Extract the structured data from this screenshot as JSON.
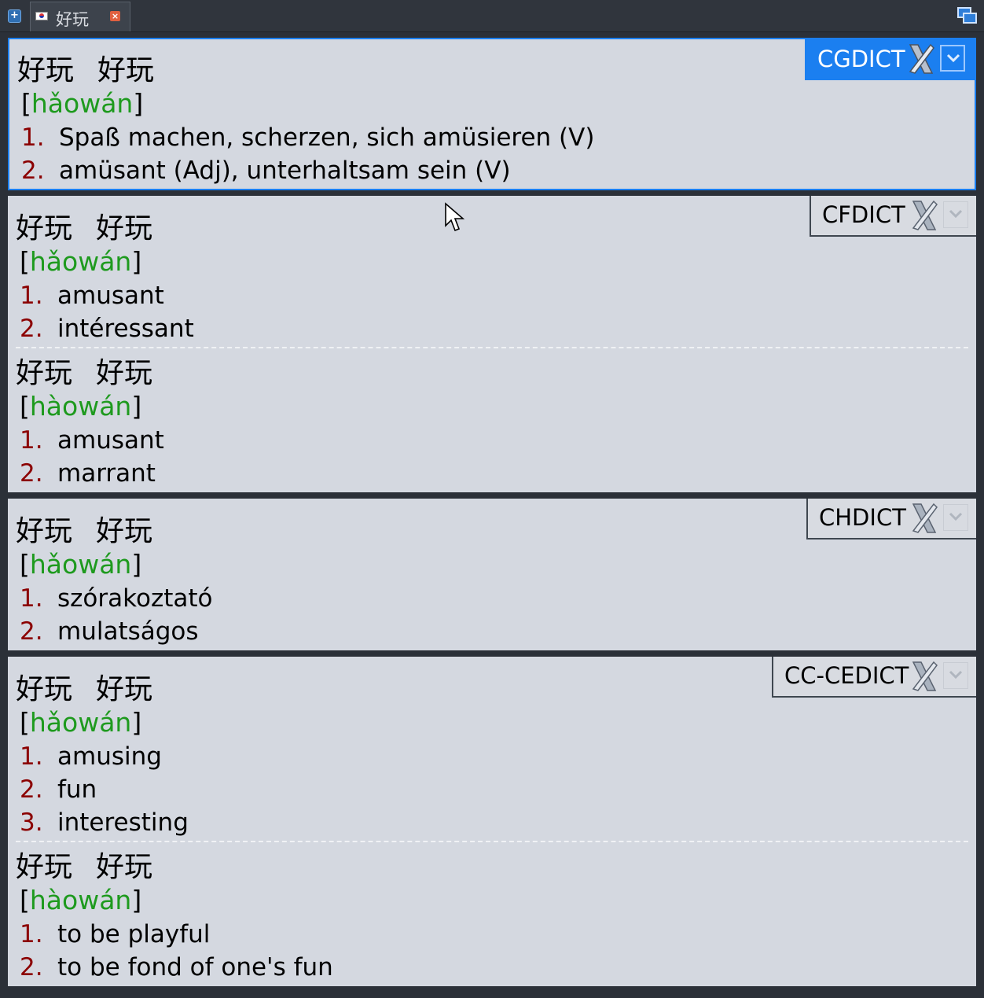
{
  "tabbar": {
    "new_tab_symbol": "+",
    "tab_title": "好玩",
    "tab_close_symbol": "×"
  },
  "panels": [
    {
      "dict": "CGDICT",
      "entries": [
        {
          "hanzi": [
            "好玩",
            "好玩"
          ],
          "pinyin": "hǎowán",
          "defs": [
            [
              "1.",
              "Spaß machen, scherzen, sich amüsieren (V)"
            ],
            [
              "2.",
              "amüsant (Adj), unterhaltsam sein (V)"
            ]
          ]
        }
      ]
    },
    {
      "dict": "CFDICT",
      "entries": [
        {
          "hanzi": [
            "好玩",
            "好玩"
          ],
          "pinyin": "hǎowán",
          "defs": [
            [
              "1.",
              "amusant"
            ],
            [
              "2.",
              "intéressant"
            ]
          ]
        },
        {
          "hanzi": [
            "好玩",
            "好玩"
          ],
          "pinyin": "hàowán",
          "defs": [
            [
              "1.",
              "amusant"
            ],
            [
              "2.",
              "marrant"
            ]
          ]
        }
      ]
    },
    {
      "dict": "CHDICT",
      "entries": [
        {
          "hanzi": [
            "好玩",
            "好玩"
          ],
          "pinyin": "hǎowán",
          "defs": [
            [
              "1.",
              "szórakoztató"
            ],
            [
              "2.",
              "mulatságos"
            ]
          ]
        }
      ]
    },
    {
      "dict": "CC-CEDICT",
      "entries": [
        {
          "hanzi": [
            "好玩",
            "好玩"
          ],
          "pinyin": "hǎowán",
          "defs": [
            [
              "1.",
              "amusing"
            ],
            [
              "2.",
              "fun"
            ],
            [
              "3.",
              "interesting"
            ]
          ]
        },
        {
          "hanzi": [
            "好玩",
            "好玩"
          ],
          "pinyin": "hàowán",
          "defs": [
            [
              "1.",
              "to be playful"
            ],
            [
              "2.",
              "to be fond of one's fun"
            ]
          ]
        }
      ]
    }
  ],
  "colors": {
    "accent": "#1b7ff0",
    "pinyin": "#1e9a1e",
    "number": "#8b0000",
    "panel_bg": "#d4d8e0",
    "app_bg": "#2b3038"
  },
  "icons": {
    "badge_logo": "x-logo-icon",
    "badge_menu": "chevron-down-icon",
    "window_button": "windows-icon"
  }
}
